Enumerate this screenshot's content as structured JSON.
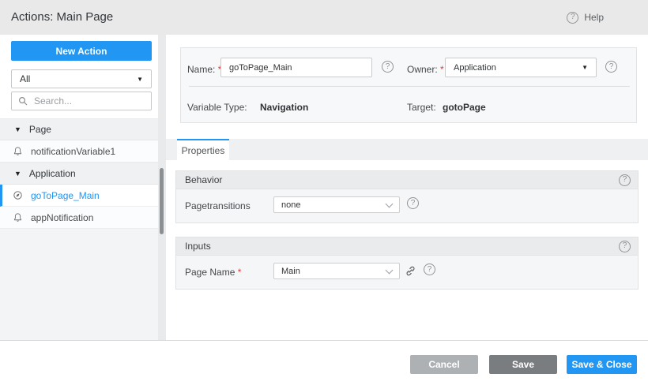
{
  "header": {
    "title": "Actions: Main Page",
    "help_label": "Help"
  },
  "icons": {
    "question_glyph": "?",
    "caret_down_glyph": "▼"
  },
  "sidebar": {
    "new_action_label": "New Action",
    "filter_value": "All",
    "search_placeholder": "Search...",
    "tree": [
      {
        "type": "group",
        "label": "Page"
      },
      {
        "type": "item",
        "label": "notificationVariable1",
        "icon": "notification-icon",
        "selected": false
      },
      {
        "type": "group",
        "label": "Application"
      },
      {
        "type": "item",
        "label": "goToPage_Main",
        "icon": "navigation-icon",
        "selected": true
      },
      {
        "type": "item",
        "label": "appNotification",
        "icon": "notification-icon",
        "selected": false
      }
    ]
  },
  "form": {
    "name_label": "Name:",
    "required_mark": "*",
    "name_value": "goToPage_Main",
    "owner_label": "Owner:",
    "owner_value": "Application",
    "variable_type_label": "Variable Type:",
    "variable_type_value": "Navigation",
    "target_label": "Target:",
    "target_value": "gotoPage"
  },
  "tabs": [
    {
      "label": "Properties",
      "active": true
    }
  ],
  "sections": [
    {
      "title": "Behavior",
      "rows": [
        {
          "label": "Pagetransitions",
          "required": false,
          "value": "none",
          "linked": false
        }
      ]
    },
    {
      "title": "Inputs",
      "rows": [
        {
          "label": "Page Name",
          "required": true,
          "value": "Main",
          "linked": true
        }
      ]
    }
  ],
  "footer": {
    "cancel_label": "Cancel",
    "save_label": "Save",
    "save_close_label": "Save & Close"
  },
  "colors": {
    "accent_blue": "#2196f3",
    "cancel_button": "#aeb1b4",
    "save_button": "#7a7d80",
    "required_asterisk": "#e53935",
    "header_background": "#e9e9e9"
  }
}
